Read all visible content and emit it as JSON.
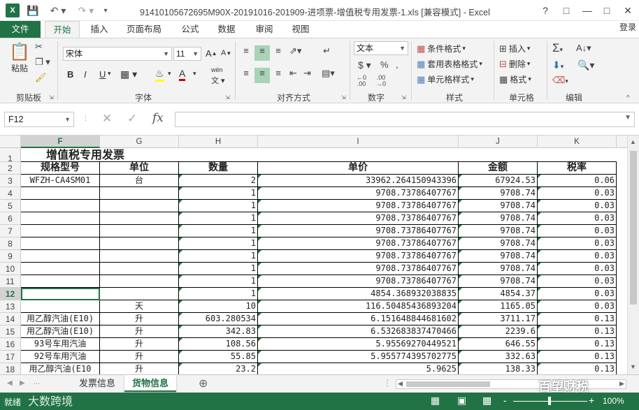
{
  "window": {
    "title": "91410105672695M90X-20191016-201909-进项票-增值税专用发票-1.xls  [兼容模式] - Excel",
    "login": "登录"
  },
  "tabs": [
    "文件",
    "开始",
    "插入",
    "页面布局",
    "公式",
    "数据",
    "审阅",
    "视图"
  ],
  "ribbon": {
    "paste_label": "粘贴",
    "font_name": "宋体",
    "font_size": "11",
    "bold": "B",
    "italic": "I",
    "underline": "U",
    "wen_label": "wén",
    "number_format": "文本",
    "cond_format": "条件格式",
    "table_format": "套用表格格式",
    "cell_style": "单元格样式",
    "insert": "插入",
    "delete": "删除",
    "format": "格式",
    "groups": {
      "clipboard": "剪贴板",
      "font": "字体",
      "alignment": "对齐方式",
      "number": "数字",
      "styles": "样式",
      "cells": "单元格",
      "editing": "编辑"
    }
  },
  "formula_bar": {
    "name_box": "F12",
    "fx": "fx",
    "formula": ""
  },
  "columns": [
    "F",
    "G",
    "H",
    "I",
    "J",
    "K"
  ],
  "selected_column": "F",
  "rows": [
    1,
    2,
    3,
    4,
    5,
    6,
    7,
    8,
    9,
    10,
    11,
    12,
    13,
    14,
    15,
    16,
    17,
    18
  ],
  "selected_row": 12,
  "sheet": {
    "title": "增值税专用发票",
    "headers": [
      "规格型号",
      "单位",
      "数量",
      "单价",
      "金额",
      "税率"
    ],
    "data": [
      [
        "WFZH-CA4SM01",
        "台",
        "2",
        "33962.264150943396",
        "67924.53",
        "0.06"
      ],
      [
        "",
        "",
        "1",
        "9708.73786407767",
        "9708.74",
        "0.03"
      ],
      [
        "",
        "",
        "1",
        "9708.73786407767",
        "9708.74",
        "0.03"
      ],
      [
        "",
        "",
        "1",
        "9708.73786407767",
        "9708.74",
        "0.03"
      ],
      [
        "",
        "",
        "1",
        "9708.73786407767",
        "9708.74",
        "0.03"
      ],
      [
        "",
        "",
        "1",
        "9708.73786407767",
        "9708.74",
        "0.03"
      ],
      [
        "",
        "",
        "1",
        "9708.73786407767",
        "9708.74",
        "0.03"
      ],
      [
        "",
        "",
        "1",
        "9708.73786407767",
        "9708.74",
        "0.03"
      ],
      [
        "",
        "",
        "1",
        "9708.73786407767",
        "9708.74",
        "0.03"
      ],
      [
        "",
        "",
        "1",
        "4854.368932038835",
        "4854.37",
        "0.03"
      ],
      [
        "",
        "天",
        "10",
        "116.50485436893204",
        "1165.05",
        "0.03"
      ],
      [
        "用乙醇汽油(E10)",
        "升",
        "603.280534",
        "6.151648844681602",
        "3711.17",
        "0.13"
      ],
      [
        "用乙醇汽油(E10)",
        "升",
        "342.83",
        "6.532683837470466",
        "2239.6",
        "0.13"
      ],
      [
        "93号车用汽油",
        "升",
        "108.56",
        "5.95569270449521",
        "646.55",
        "0.13"
      ],
      [
        "92号车用汽油",
        "升",
        "55.85",
        "5.955774395702775",
        "332.63",
        "0.13"
      ],
      [
        "用乙醇汽油(E10",
        "升",
        "23.2",
        "5.9625",
        "138.33",
        "0.13"
      ]
    ]
  },
  "sheet_tabs": [
    "发票信息",
    "货物信息"
  ],
  "active_sheet": "货物信息",
  "status": {
    "ready": "就绪",
    "zoom": "100%"
  },
  "watermarks": [
    "百望财税",
    "大数跨境"
  ]
}
